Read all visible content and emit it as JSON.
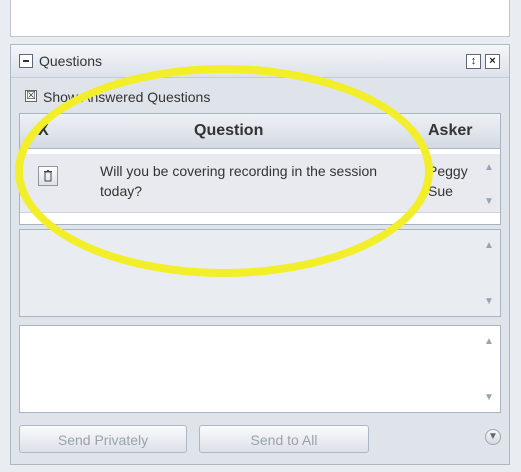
{
  "panel": {
    "title": "Questions",
    "checkbox_label": "Show Answered Questions"
  },
  "table": {
    "columns": [
      "X",
      "Question",
      "Asker"
    ],
    "rows": [
      {
        "question": "Will you be covering recording in the session today?",
        "asker": "Peggy Sue"
      }
    ]
  },
  "buttons": {
    "send_privately": "Send Privately",
    "send_to_all": "Send to All"
  },
  "colors": {
    "overlay": "#f2ef2a"
  },
  "icons": {
    "collapse": "minus-icon",
    "restore": "restore-icon",
    "close": "close-icon",
    "delete": "trash-icon"
  }
}
